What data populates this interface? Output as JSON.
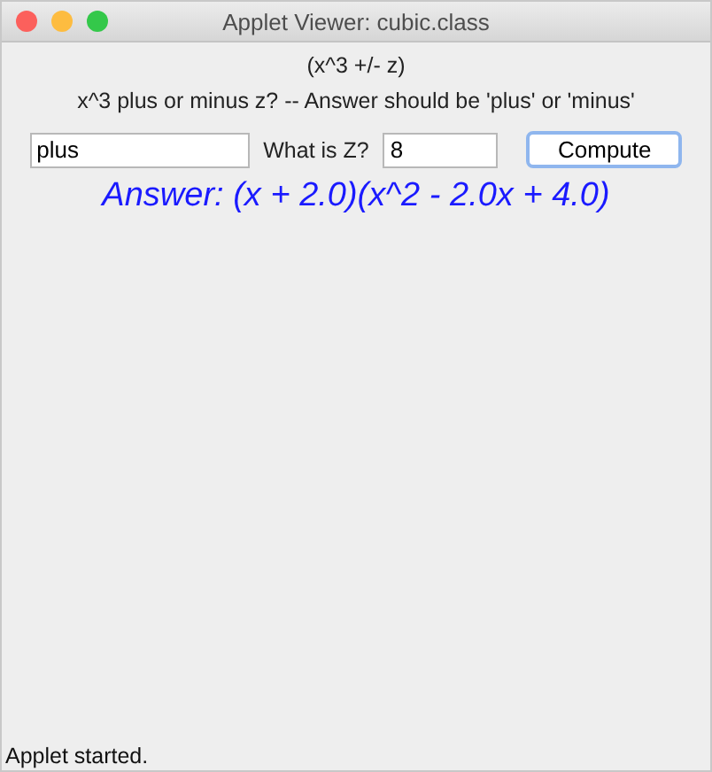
{
  "window": {
    "title": "Applet Viewer: cubic.class"
  },
  "heading": "(x^3 +/- z)",
  "prompt": "x^3 plus or minus z? -- Answer should be 'plus' or 'minus'",
  "sign_field": {
    "value": "plus"
  },
  "z_label": "What is Z?",
  "z_field": {
    "value": "8"
  },
  "compute_button": {
    "label": "Compute"
  },
  "answer": "Answer: (x + 2.0)(x^2 - 2.0x + 4.0)",
  "status_bar": "Applet started."
}
